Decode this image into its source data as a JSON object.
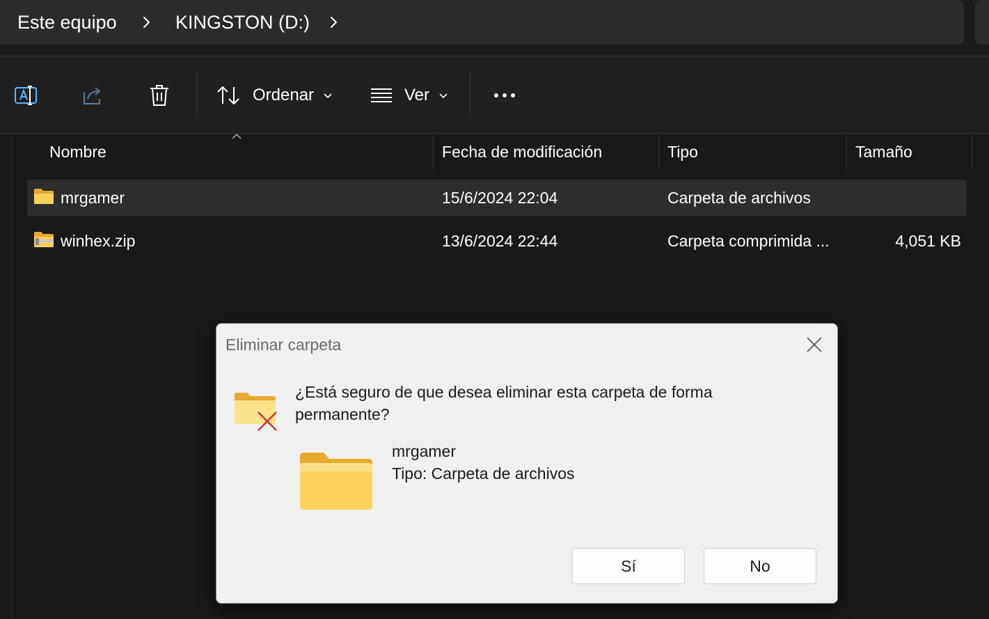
{
  "breadcrumb": {
    "items": [
      "Este equipo",
      "KINGSTON (D:)"
    ]
  },
  "toolbar": {
    "rename_icon": "rename-icon",
    "share_icon": "share-icon",
    "delete_icon": "trash-icon",
    "sort_label": "Ordenar",
    "view_label": "Ver",
    "more_icon": "more-icon"
  },
  "columns": {
    "name": "Nombre",
    "date": "Fecha de modificación",
    "type": "Tipo",
    "size": "Tamaño"
  },
  "files": [
    {
      "name": "mrgamer",
      "date": "15/6/2024 22:04",
      "type": "Carpeta de archivos",
      "size": "",
      "icon": "folder-icon"
    },
    {
      "name": "winhex.zip",
      "date": "13/6/2024 22:44",
      "type": "Carpeta comprimida ...",
      "size": "4,051 KB",
      "icon": "zip-folder-icon"
    }
  ],
  "dialog": {
    "title": "Eliminar carpeta",
    "question": "¿Está seguro de que desea eliminar esta carpeta de forma permanente?",
    "item_name": "mrgamer",
    "item_type": "Tipo: Carpeta de archivos",
    "yes_label": "Sí",
    "no_label": "No"
  },
  "colors": {
    "folder": "#f7c948",
    "background": "#191919",
    "dialog_bg": "#f0f0f0",
    "delete_x": "#d13438"
  }
}
